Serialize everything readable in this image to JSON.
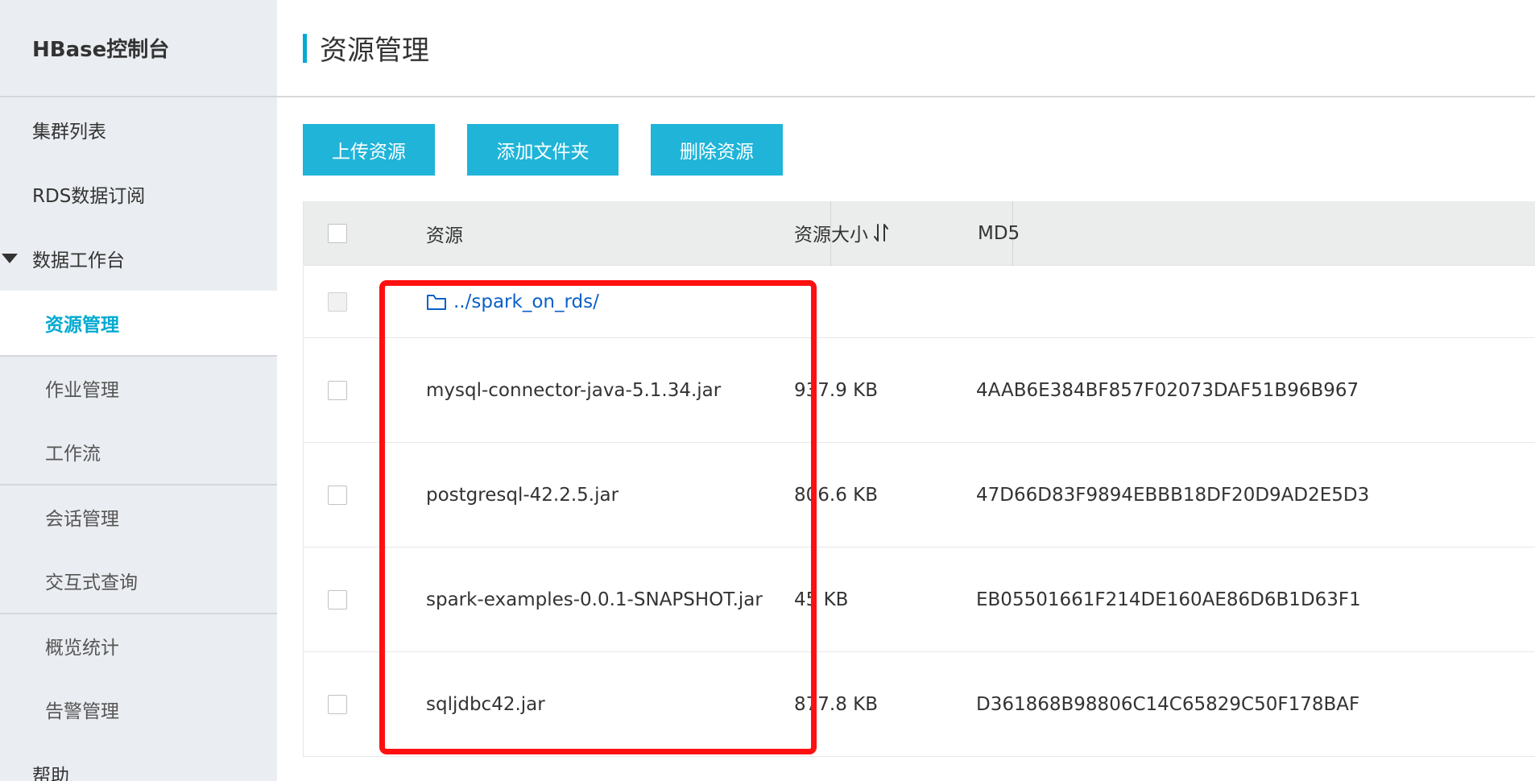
{
  "app": {
    "title": "HBase控制台"
  },
  "sidebar": {
    "items": [
      {
        "label": "集群列表"
      },
      {
        "label": "RDS数据订阅"
      },
      {
        "label": "数据工作台"
      },
      {
        "label": "资源管理"
      },
      {
        "label": "作业管理"
      },
      {
        "label": "工作流"
      },
      {
        "label": "会话管理"
      },
      {
        "label": "交互式查询"
      },
      {
        "label": "概览统计"
      },
      {
        "label": "告警管理"
      },
      {
        "label": "帮助"
      }
    ]
  },
  "page": {
    "title": "资源管理"
  },
  "toolbar": {
    "upload_label": "上传资源",
    "add_folder_label": "添加文件夹",
    "delete_label": "删除资源"
  },
  "table": {
    "headers": {
      "resource": "资源",
      "size": "资源大小",
      "md5": "MD5"
    },
    "parent_folder": "../spark_on_rds/",
    "rows": [
      {
        "name": "mysql-connector-java-5.1.34.jar",
        "size": "937.9 KB",
        "md5": "4AAB6E384BF857F02073DAF51B96B967"
      },
      {
        "name": "postgresql-42.2.5.jar",
        "size": "806.6 KB",
        "md5": "47D66D83F9894EBBB18DF20D9AD2E5D3"
      },
      {
        "name": "spark-examples-0.0.1-SNAPSHOT.jar",
        "size": "45 KB",
        "md5": "EB05501661F214DE160AE86D6B1D63F1"
      },
      {
        "name": "sqljdbc42.jar",
        "size": "877.8 KB",
        "md5": "D361868B98806C14C65829C50F178BAF"
      }
    ]
  },
  "icons": {
    "folder": "folder-icon",
    "sort": "sort-icon",
    "caret": "caret-down-icon"
  },
  "colors": {
    "accent": "#00aad2",
    "button": "#1fb4d8",
    "link": "#0a60c8",
    "highlight": "#ff1010",
    "sidebar_bg": "#eaedf1"
  }
}
